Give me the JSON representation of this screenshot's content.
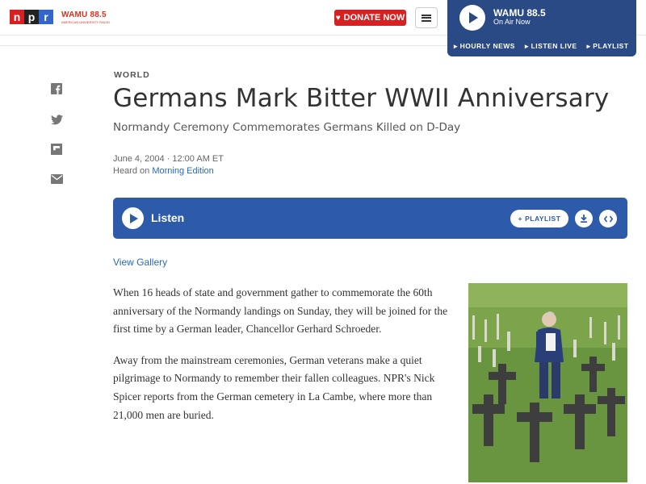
{
  "header": {
    "logo_letters": [
      "n",
      "p",
      "r"
    ],
    "station_logo": "WAMU 88.5",
    "station_tagline": "AMERICAN UNIVERSITY RADIO",
    "donate_label": "DONATE NOW",
    "menu_icon": "hamburger-icon"
  },
  "player": {
    "station": "WAMU 88.5",
    "status": "On Air Now",
    "links": [
      "HOURLY NEWS",
      "LISTEN LIVE",
      "PLAYLIST"
    ]
  },
  "share": {
    "icons": [
      "facebook-icon",
      "twitter-icon",
      "flipboard-icon",
      "email-icon"
    ]
  },
  "article": {
    "section": "WORLD",
    "title": "Germans Mark Bitter WWII Anniversary",
    "subtitle": "Normandy Ceremony Commemorates Germans Killed on D-Day",
    "date": "June 4, 2004 · 12:00 AM ET",
    "heard_prefix": "Heard on",
    "heard_program": "Morning Edition",
    "listen_label": "Listen",
    "playlist_label": "PLAYLIST",
    "view_gallery": "View Gallery",
    "paragraphs": [
      "When 16 heads of state and government gather to commemorate the 60th anniversary of the Normandy landings on Sunday, they will be joined for the first time by a German leader, Chancellor Gerhard Schroeder.",
      "Away from the mainstream ceremonies, German veterans make a quiet pilgrimage to Normandy to remember their fallen colleagues. NPR's Nick Spicer reports from the German cemetery in La Cambe, where more than 21,000 men are buried."
    ]
  },
  "colors": {
    "npr_red": "#d62021",
    "player_blue": "#2a4a86",
    "listen_blue": "#2e5ba9",
    "link_blue": "#2a6ab8"
  }
}
